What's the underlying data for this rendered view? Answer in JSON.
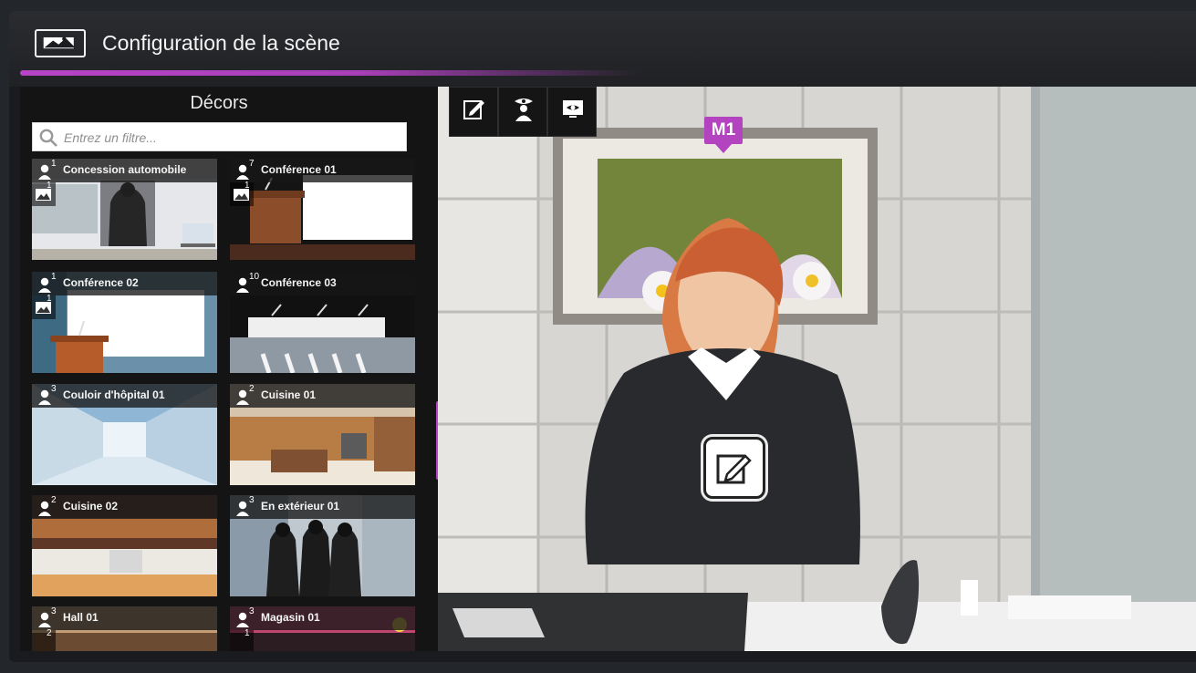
{
  "app": {
    "title": "Configuration de la scène"
  },
  "decor_panel": {
    "title": "Décors",
    "filter_placeholder": "Entrez un filtre...",
    "tiles": [
      {
        "name": "Concession automobile",
        "person_count": "1",
        "image_count": "1"
      },
      {
        "name": "Conférence 01",
        "person_count": "7",
        "image_count": "1"
      },
      {
        "name": "Conférence 02",
        "person_count": "1",
        "image_count": "1"
      },
      {
        "name": "Conférence 03",
        "person_count": "10",
        "image_count": ""
      },
      {
        "name": "Couloir d'hôpital 01",
        "person_count": "3",
        "image_count": ""
      },
      {
        "name": "Cuisine 01",
        "person_count": "2",
        "image_count": ""
      },
      {
        "name": "Cuisine 02",
        "person_count": "2",
        "image_count": ""
      },
      {
        "name": "En extérieur 01",
        "person_count": "3",
        "image_count": ""
      },
      {
        "name": "Hall 01",
        "person_count": "3",
        "image_count": "2"
      },
      {
        "name": "Magasin 01",
        "person_count": "3",
        "image_count": "1"
      }
    ]
  },
  "stage": {
    "marker": "M1"
  }
}
